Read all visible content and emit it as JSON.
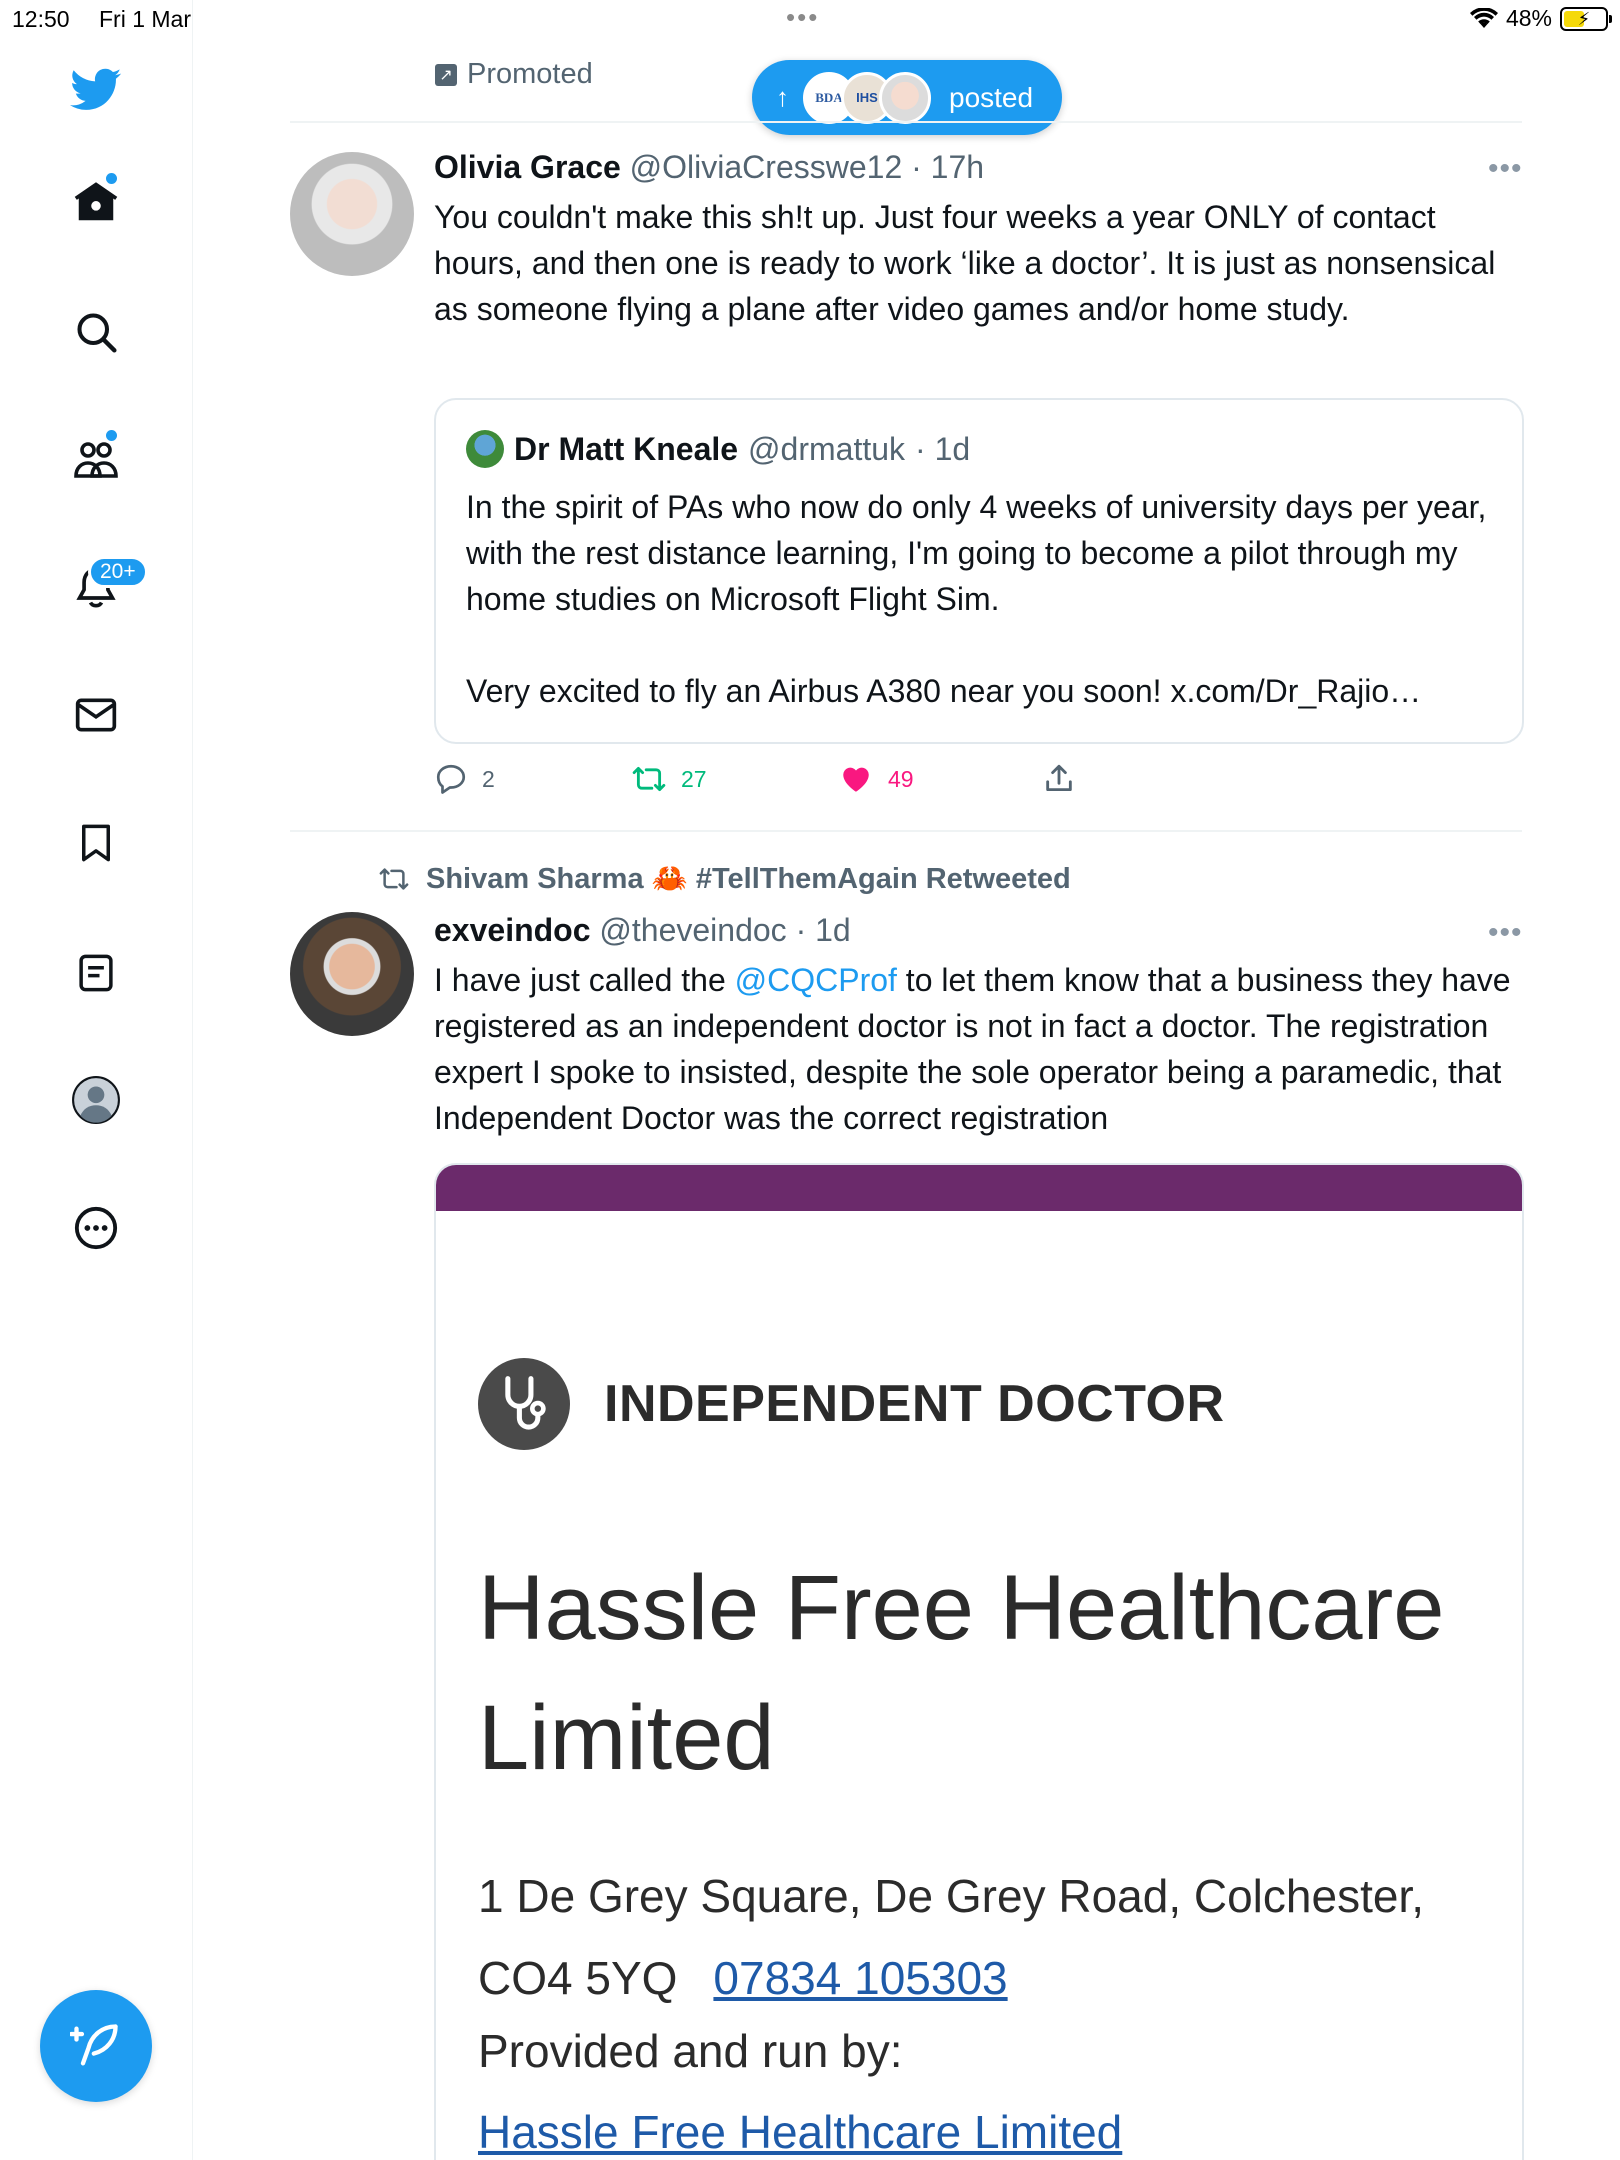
{
  "status_bar": {
    "time": "12:50",
    "date": "Fri 1 Mar",
    "multitask_dots": "•••",
    "battery": "48%"
  },
  "sidebar": {
    "items": [
      {
        "name": "twitter-logo",
        "icon": "bird"
      },
      {
        "name": "home",
        "icon": "home",
        "has_dot": true
      },
      {
        "name": "explore",
        "icon": "search"
      },
      {
        "name": "communities",
        "icon": "people",
        "has_dot": true
      },
      {
        "name": "notifications",
        "icon": "bell",
        "badge": "20+"
      },
      {
        "name": "messages",
        "icon": "envelope"
      },
      {
        "name": "bookmarks",
        "icon": "bookmark"
      },
      {
        "name": "lists",
        "icon": "list"
      },
      {
        "name": "profile",
        "icon": "avatar"
      },
      {
        "name": "more",
        "icon": "ellipsis-circle"
      }
    ],
    "compose_icon": "feather-plus",
    "accent": "#1d9bf0"
  },
  "feed": {
    "promoted_label": "Promoted",
    "new_posts_pill": {
      "label": "posted",
      "avatars": [
        "BDA",
        "IHS",
        ""
      ]
    },
    "tweets": [
      {
        "name": "Olivia Grace",
        "handle": "@OliviaCresswe12",
        "time": "· 17h",
        "more": "•••",
        "text": "You couldn't make this sh!t up. Just four weeks a year ONLY of contact hours, and then one is ready to work ‘like a doctor’. It is just as nonsensical as someone flying a plane after video games and/or home study.",
        "quote": {
          "name": "Dr Matt Kneale",
          "handle": "@drmattuk",
          "time": "· 1d",
          "text_line1": "In the spirit of PAs who now do only 4 weeks of university days per year, with the rest distance learning, I'm going to become a pilot through my home studies on Microsoft Flight Sim.",
          "text_line2": "Very excited to fly an Airbus A380 near you soon! x.com/Dr_Rajio…"
        },
        "actions": {
          "replies": "2",
          "retweets": "27",
          "likes": "49"
        }
      },
      {
        "retweeted_by": "Shivam Sharma 🦀 #TellThemAgain Retweeted",
        "name": "exveindoc",
        "handle": "@theveindoc",
        "time": "· 1d",
        "more": "•••",
        "text_before": "I have just called the ",
        "mention": "@CQCProf",
        "text_after": " to let them know that a business they have registered as an independent doctor is not in fact a doctor. The registration expert I spoke to insisted, despite the sole operator being a paramedic, that Independent Doctor was the correct registration",
        "media": {
          "category": "INDEPENDENT DOCTOR",
          "title": "Hassle Free Healthcare Limited",
          "address": "1 De Grey Square, De Grey Road, Colchester, CO4 5YQ",
          "phone": "07834 105303",
          "provided_label": "Provided and run by:",
          "provider_link": "Hassle Free Healthcare Limited",
          "header_color": "#6b2a6b"
        }
      }
    ]
  }
}
